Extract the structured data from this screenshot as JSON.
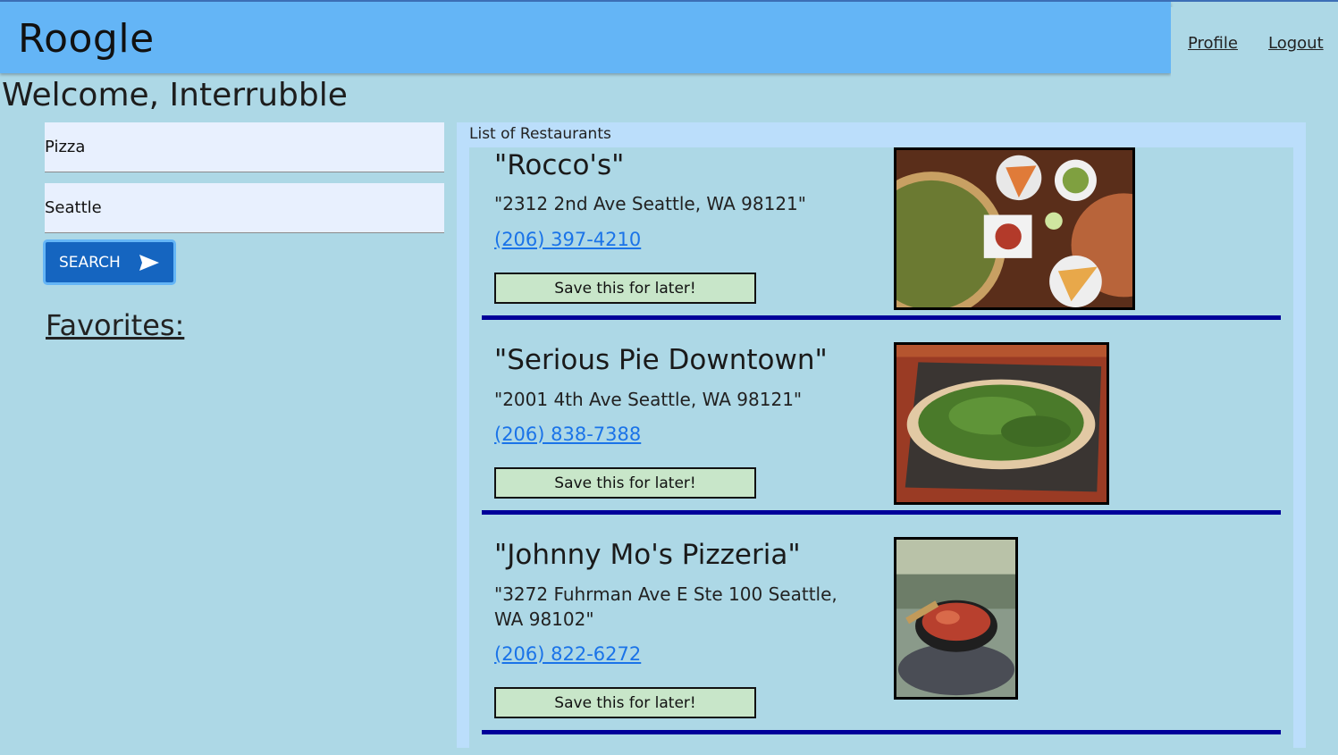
{
  "header": {
    "app_title": "Roogle",
    "nav": {
      "profile": "Profile",
      "logout": "Logout"
    }
  },
  "welcome": "Welcome, Interrubble",
  "search": {
    "query_value": "Pizza",
    "location_value": "Seattle",
    "button_label": "SEARCH"
  },
  "favorites": {
    "title": "Favorites:"
  },
  "results": {
    "label": "List of Restaurants",
    "items": [
      {
        "name": "\"Rocco's\"",
        "address": "\"2312 2nd Ave Seattle, WA 98121\"",
        "phone": "(206) 397-4210",
        "save_label": "Save this for later!"
      },
      {
        "name": "\"Serious Pie Downtown\"",
        "address": "\"2001 4th Ave Seattle, WA 98121\"",
        "phone": "(206) 838-7388",
        "save_label": "Save this for later!"
      },
      {
        "name": "\"Johnny Mo's Pizzeria\"",
        "address": "\"3272 Fuhrman Ave E Ste 100 Seattle, WA 98102\"",
        "phone": "(206) 822-6272",
        "save_label": "Save this for later!"
      }
    ]
  },
  "colors": {
    "page_bg": "#add8e6",
    "header_bg": "#64b5f6",
    "search_button": "#1565c0",
    "save_button": "#c8e6c9",
    "divider": "#000099",
    "link": "#1a73e8"
  }
}
